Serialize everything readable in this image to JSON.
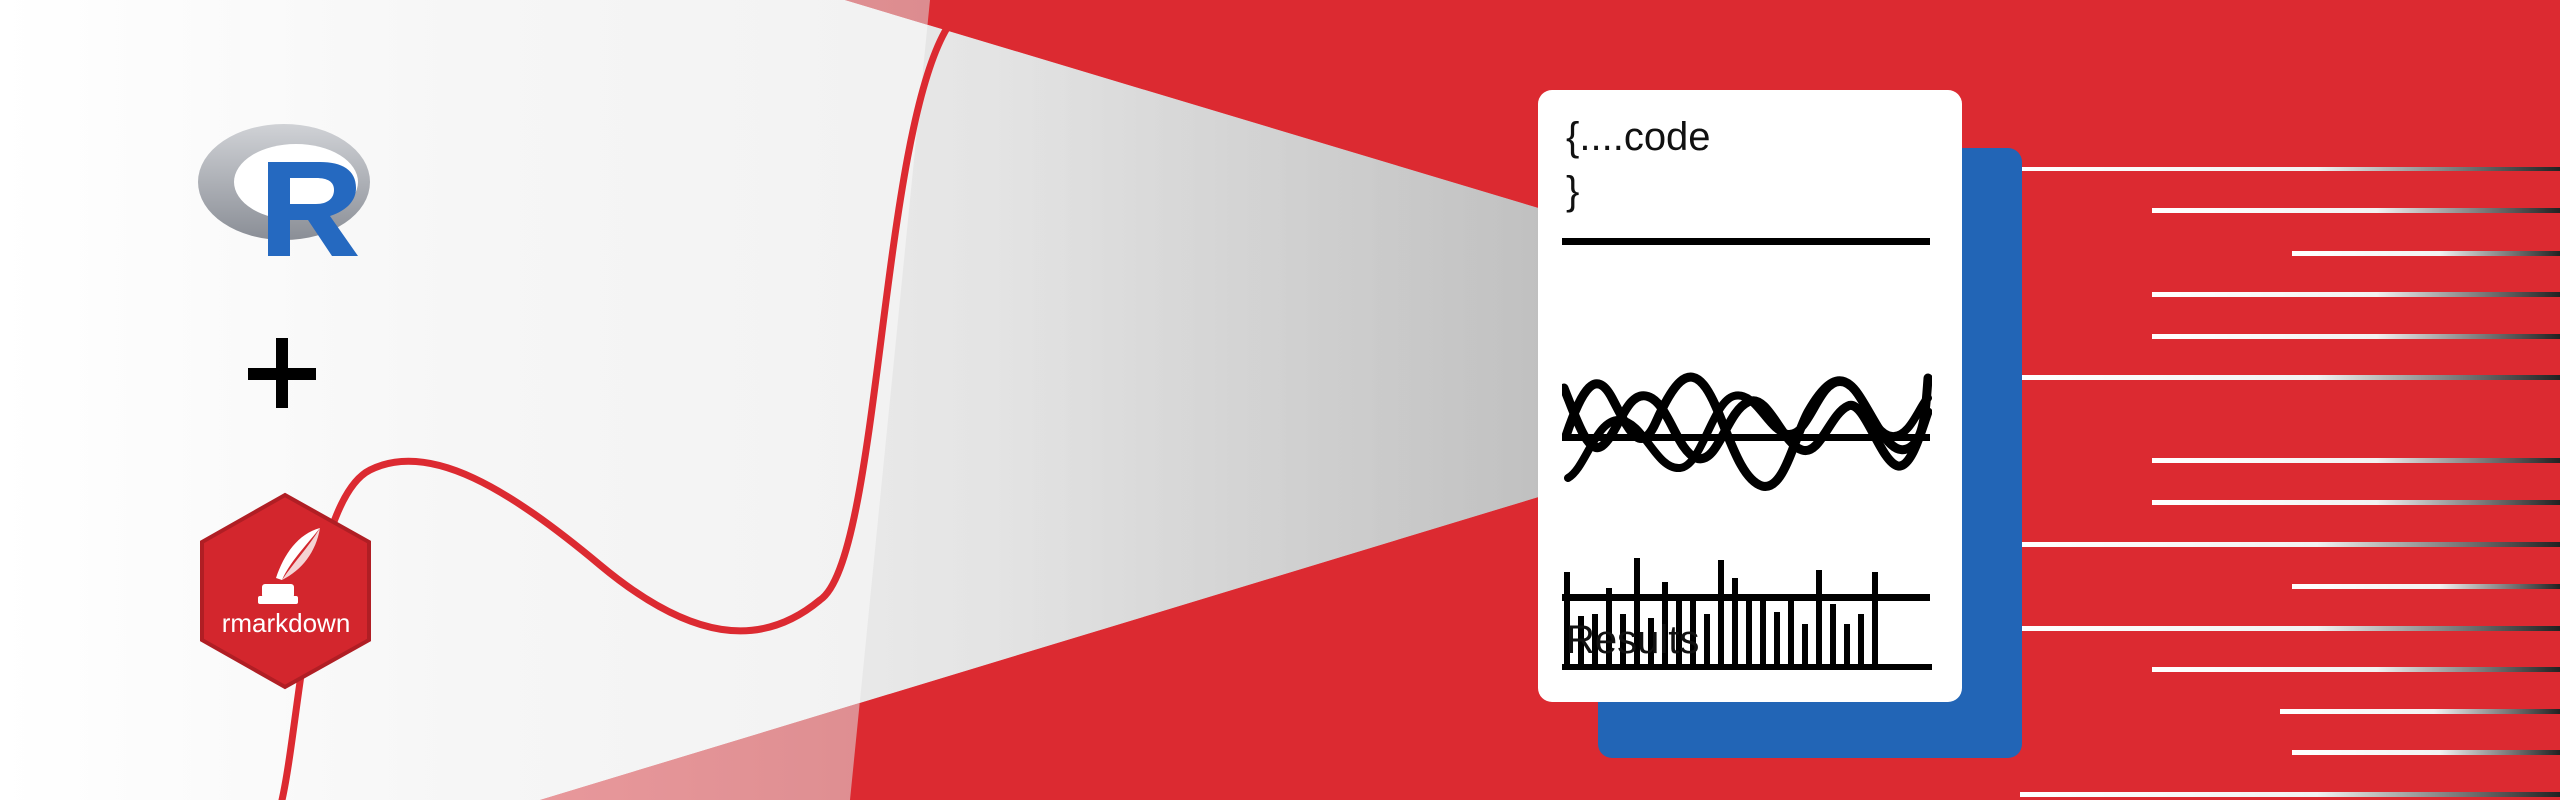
{
  "card": {
    "code_line1": "{....code",
    "code_line2": "}",
    "results_label": "Results"
  },
  "logos": {
    "r_letter": "R",
    "plus": "+",
    "rmarkdown_label": "rmarkdown"
  },
  "colors": {
    "red": "#dc2a31",
    "blue": "#2265b6",
    "white": "#ffffff",
    "black": "#000000",
    "r_blue": "#2569c0",
    "r_gray": "#9a9ea6",
    "hex_red": "#d3262d"
  },
  "icons": [
    "r-logo-icon",
    "plus-icon",
    "rmarkdown-hex-icon",
    "quill-icon"
  ]
}
